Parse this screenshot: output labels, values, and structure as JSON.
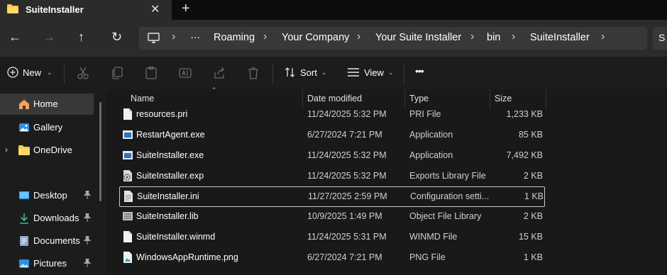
{
  "tab": {
    "title": "SuiteInstaller",
    "close": "✕",
    "new_tab": "+"
  },
  "nav": {
    "back": "←",
    "forward": "→",
    "up": "↑",
    "refresh": "↻",
    "more": "…"
  },
  "breadcrumb": [
    "Roaming",
    "Your Company",
    "Your Suite Installer",
    "bin",
    "SuiteInstaller"
  ],
  "breadcrumb_sep": "›",
  "search": {
    "label": "S"
  },
  "toolbar": {
    "new_label": "New",
    "sort_label": "Sort",
    "view_label": "View",
    "more": "•••"
  },
  "sidebar": {
    "items": [
      {
        "label": "Home",
        "icon": "home-icon",
        "selected": true
      },
      {
        "label": "Gallery",
        "icon": "gallery-icon"
      },
      {
        "label": "OneDrive",
        "icon": "folder-icon",
        "expander": "›"
      },
      {
        "label": "Desktop",
        "icon": "desktop-icon",
        "pinned": true
      },
      {
        "label": "Downloads",
        "icon": "download-icon",
        "pinned": true
      },
      {
        "label": "Documents",
        "icon": "documents-icon",
        "pinned": true
      },
      {
        "label": "Pictures",
        "icon": "pictures-icon",
        "pinned": true
      }
    ]
  },
  "columns": {
    "name": "Name",
    "date": "Date modified",
    "type": "Type",
    "size": "Size"
  },
  "files": [
    {
      "name": "resources.pri",
      "date": "11/24/2025 5:32 PM",
      "type": "PRI File",
      "size": "1,233 KB",
      "icon": "file-icon"
    },
    {
      "name": "RestartAgent.exe",
      "date": "6/27/2024 7:21 PM",
      "type": "Application",
      "size": "85 KB",
      "icon": "app-icon"
    },
    {
      "name": "SuiteInstaller.exe",
      "date": "11/24/2025 5:32 PM",
      "type": "Application",
      "size": "7,492 KB",
      "icon": "app-icon"
    },
    {
      "name": "SuiteInstaller.exp",
      "date": "11/24/2025 5:32 PM",
      "type": "Exports Library File",
      "size": "2 KB",
      "icon": "gear-file-icon"
    },
    {
      "name": "SuiteInstaller.ini",
      "date": "11/27/2025 2:59 PM",
      "type": "Configuration setti...",
      "size": "1 KB",
      "icon": "config-file-icon",
      "selected": true
    },
    {
      "name": "SuiteInstaller.lib",
      "date": "10/9/2025 1:49 PM",
      "type": "Object File Library",
      "size": "2 KB",
      "icon": "library-file-icon"
    },
    {
      "name": "SuiteInstaller.winmd",
      "date": "11/24/2025 5:31 PM",
      "type": "WINMD File",
      "size": "15 KB",
      "icon": "file-icon"
    },
    {
      "name": "WindowsAppRuntime.png",
      "date": "6/27/2024 7:21 PM",
      "type": "PNG File",
      "size": "1 KB",
      "icon": "image-file-icon"
    }
  ],
  "colors": {
    "accent": "#4cc2ff",
    "folder": "#f7c948",
    "selected_bg": "#383838"
  }
}
